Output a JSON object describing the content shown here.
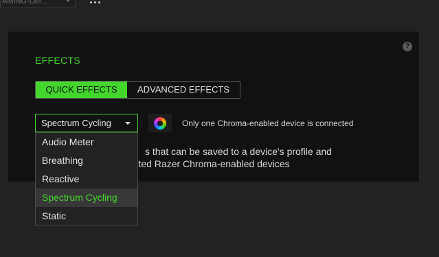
{
  "top": {
    "profile_name": "AMING-Def...",
    "more_label": "..."
  },
  "effects": {
    "title": "EFFECTS",
    "tabs": [
      {
        "label": "QUICK EFFECTS",
        "active": true
      },
      {
        "label": "ADVANCED EFFECTS",
        "active": false
      }
    ],
    "selected_effect": "Spectrum Cycling",
    "note": "Only one Chroma-enabled device is connected",
    "description": "s that can be saved to a device's profile and\norted Razer Chroma-enabled devices",
    "options": [
      "Audio Meter",
      "Breathing",
      "Reactive",
      "Spectrum Cycling",
      "Static"
    ],
    "selected_index": 3
  },
  "colors": {
    "accent": "#44d62c",
    "panel_bg": "#111111",
    "page_bg": "#222222"
  },
  "icons": {
    "help": "help-question-icon",
    "chroma": "chroma-ring-icon",
    "caret": "chevron-down-icon",
    "more": "more-dots-icon"
  }
}
